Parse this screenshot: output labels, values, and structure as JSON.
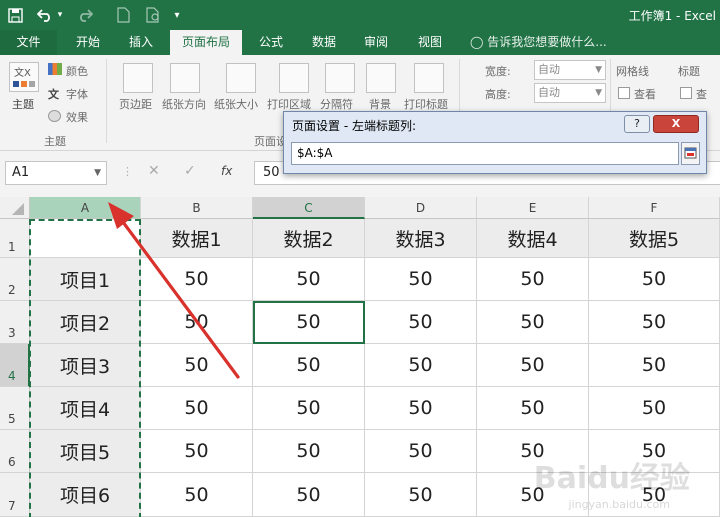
{
  "window": {
    "title": "工作簿1 - Excel"
  },
  "tabs": [
    {
      "label": "文件"
    },
    {
      "label": "开始"
    },
    {
      "label": "插入"
    },
    {
      "label": "页面布局"
    },
    {
      "label": "公式"
    },
    {
      "label": "数据"
    },
    {
      "label": "审阅"
    },
    {
      "label": "视图"
    }
  ],
  "tell_me": "告诉我您想要做什么...",
  "ribbon": {
    "theme_btn": "主题",
    "colors": "颜色",
    "fonts": "字体",
    "effects": "效果",
    "theme_group": "主题",
    "margins": "页边距",
    "orientation": "纸张方向",
    "size": "纸张大小",
    "print_area": "打印区域",
    "breaks": "分隔符",
    "background": "背景",
    "print_titles": "打印标题",
    "page_group": "页面设置",
    "width_lbl": "宽度:",
    "height_lbl": "高度:",
    "width_val": "自动",
    "height_val": "自动",
    "gridlines": "网格线",
    "headings": "标题",
    "view_lbl": "查看",
    "view_lbl2": "查"
  },
  "formula_bar": {
    "name_box": "A1",
    "value": "50",
    "fx": "fx"
  },
  "dialog": {
    "title": "页面设置 - 左端标题列:",
    "help": "?",
    "close": "X",
    "value": "$A:$A"
  },
  "columns": [
    "A",
    "B",
    "C",
    "D",
    "E",
    "F"
  ],
  "rows": [
    "1",
    "2",
    "3",
    "4",
    "5",
    "6",
    "7"
  ],
  "header_row": [
    "",
    "数据1",
    "数据2",
    "数据3",
    "数据4",
    "数据5"
  ],
  "data_rows": [
    [
      "项目1",
      "50",
      "50",
      "50",
      "50",
      "50"
    ],
    [
      "项目2",
      "50",
      "50",
      "50",
      "50",
      "50"
    ],
    [
      "项目3",
      "50",
      "50",
      "50",
      "50",
      "50"
    ],
    [
      "项目4",
      "50",
      "50",
      "50",
      "50",
      "50"
    ],
    [
      "项目5",
      "50",
      "50",
      "50",
      "50",
      "50"
    ],
    [
      "项目6",
      "50",
      "50",
      "50",
      "50",
      "50"
    ]
  ],
  "watermark": {
    "main": "Baidu经验",
    "sub": "jingyan.baidu.com"
  },
  "colors": {
    "excel_green": "#217346",
    "annotation_arrow": "#d9312b"
  }
}
